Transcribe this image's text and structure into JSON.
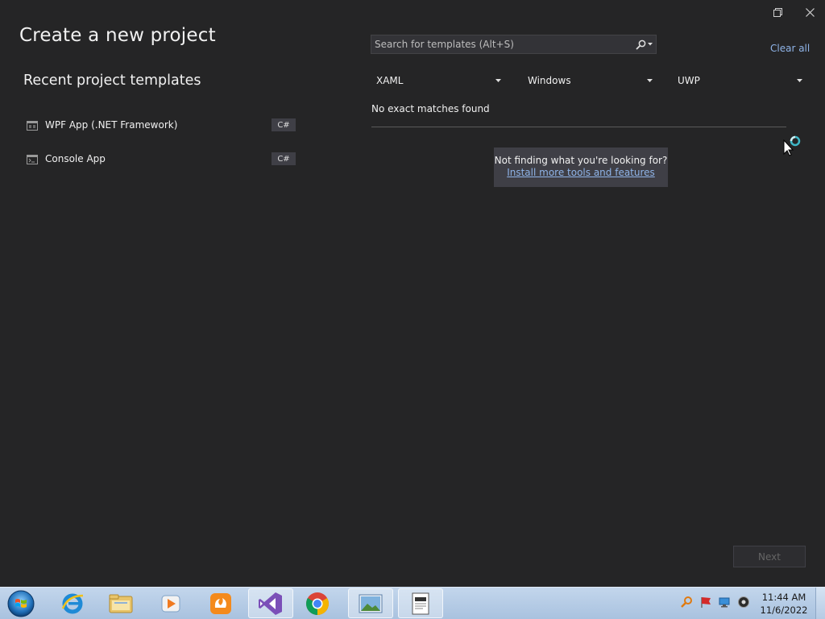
{
  "window": {
    "restore_label": "restore",
    "close_label": "close"
  },
  "page": {
    "title": "Create a new project",
    "recent_title": "Recent project templates"
  },
  "recent_templates": [
    {
      "label": "WPF App (.NET Framework)",
      "language": "C#",
      "icon": "wpf-app-icon"
    },
    {
      "label": "Console App",
      "language": "C#",
      "icon": "console-app-icon"
    }
  ],
  "search": {
    "placeholder": "Search for templates (Alt+S)",
    "value": ""
  },
  "clear_all": "Clear all",
  "filters": {
    "language": "XAML",
    "platform": "Windows",
    "project_type": "UWP"
  },
  "results": {
    "no_match": "No exact matches found",
    "hint_text": "Not finding what you're looking for?",
    "hint_link": "Install more tools and features"
  },
  "footer": {
    "next_label": "Next"
  },
  "taskbar": {
    "apps": [
      "internet-explorer-icon",
      "file-explorer-icon",
      "media-player-icon",
      "uc-browser-icon",
      "visual-studio-icon",
      "chrome-icon",
      "photo-viewer-icon",
      "notepad-icon"
    ],
    "active_app": "visual-studio-icon",
    "tray": [
      "search-tray-icon",
      "flag-icon",
      "network-icon",
      "volume-icon"
    ],
    "time": "11:44 AM",
    "date": "11/6/2022"
  },
  "colors": {
    "background": "#252526",
    "link": "#8fb4e8",
    "badge": "#3f3f46",
    "vs_purple": "#68217a"
  }
}
